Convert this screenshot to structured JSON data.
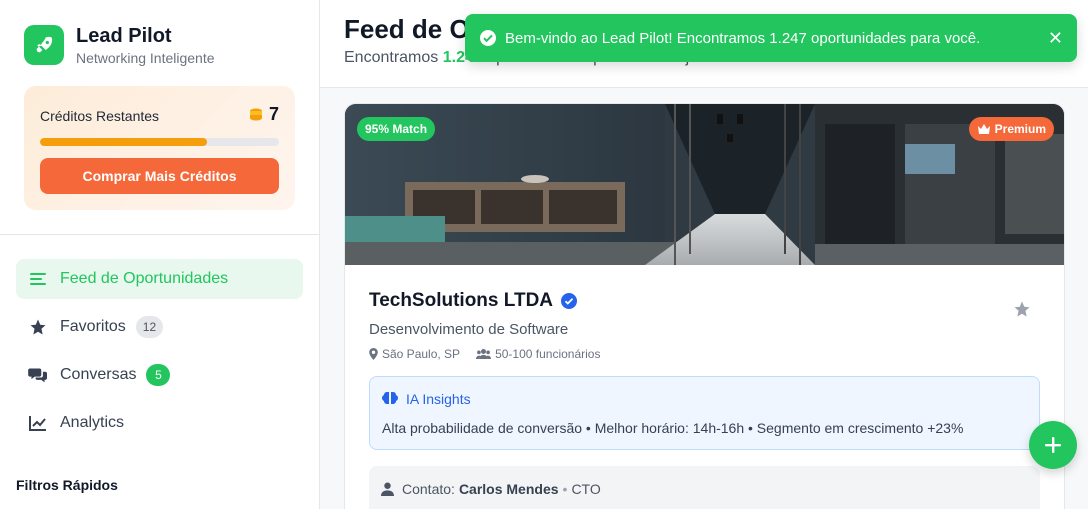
{
  "brand": {
    "title": "Lead Pilot",
    "subtitle": "Networking Inteligente",
    "logo_icon": "rocket-icon",
    "accent": "#22c55e"
  },
  "credits": {
    "label": "Créditos Restantes",
    "count": "7",
    "icon": "coins-icon",
    "progress": 0.7,
    "buy_label": "Comprar Mais Créditos",
    "buy_color": "#f4683a"
  },
  "nav": {
    "items": [
      {
        "label": "Feed de Oportunidades",
        "icon": "list-icon",
        "active": true
      },
      {
        "label": "Favoritos",
        "icon": "star-icon",
        "badge": "12"
      },
      {
        "label": "Conversas",
        "icon": "chat-icon",
        "badge": "5"
      },
      {
        "label": "Analytics",
        "icon": "chart-line-icon"
      }
    ]
  },
  "filters": {
    "title": "Filtros Rápidos"
  },
  "header": {
    "title": "Feed de Oportunidades",
    "subtitle_prefix": "Encontramos ",
    "subtitle_count": "1.247",
    "subtitle_suffix": " oportunidades para você hoje"
  },
  "card": {
    "match": "95% Match",
    "premium": "Premium",
    "company": "TechSolutions LTDA",
    "sector": "Desenvolvimento de Software",
    "location": "São Paulo, SP",
    "employees": "50-100 funcionários",
    "insights_title": "IA Insights",
    "insights_text": "Alta probabilidade de conversão • Melhor horário: 14h-16h • Segmento em crescimento +23%",
    "contact_label": "Contato:",
    "contact_name": "Carlos Mendes",
    "contact_sep": "•",
    "contact_role": "CTO"
  },
  "toast": {
    "message": "Bem-vindo ao Lead Pilot! Encontramos 1.247 oportunidades para você.",
    "close": "✕",
    "color": "#22c55e"
  }
}
